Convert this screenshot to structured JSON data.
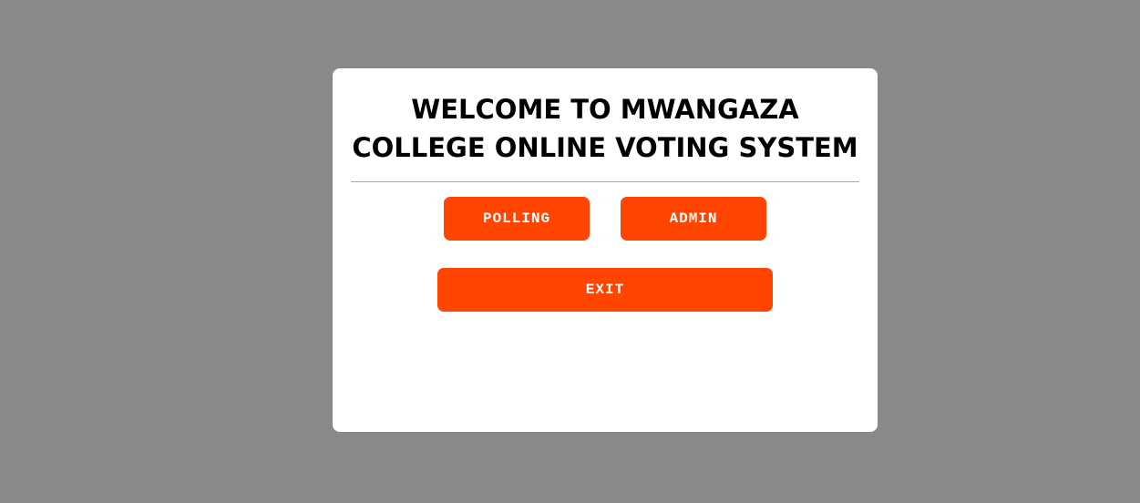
{
  "page": {
    "background_color": "#898989"
  },
  "card": {
    "title": "WELCOME TO MWANGAZA\nCOLLEGE ONLINE VOTING SYSTEM"
  },
  "buttons": {
    "polling_label": "POLLING",
    "admin_label": "ADMIN",
    "exit_label": "EXIT",
    "color": "#ff4500"
  }
}
